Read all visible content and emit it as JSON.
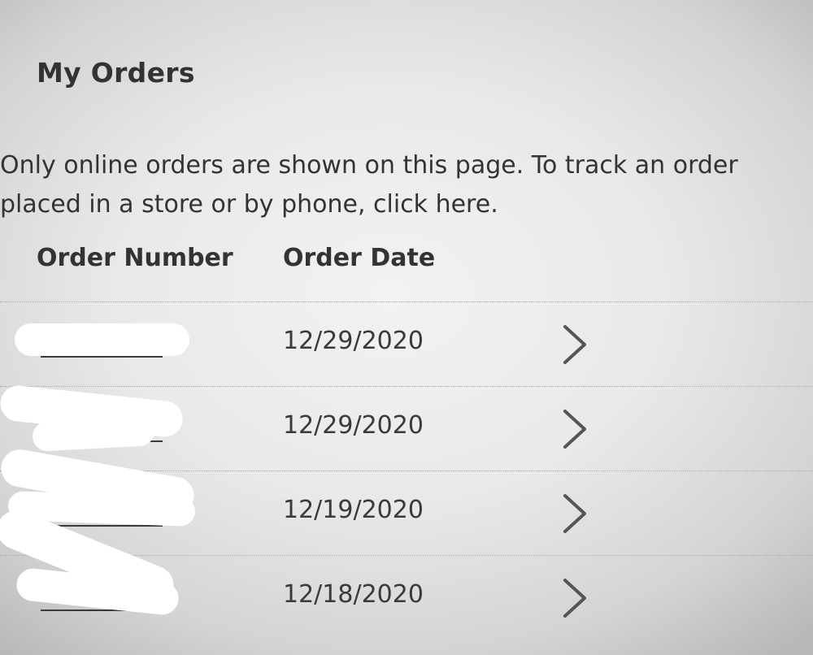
{
  "page": {
    "title": "My Orders",
    "notice": "Only online orders are shown on this page. To track an order placed in a store or by phone, click here."
  },
  "table": {
    "headers": {
      "order_number": "Order Number",
      "order_date": "Order Date"
    },
    "rows": [
      {
        "order_number": "",
        "order_date": "12/29/2020",
        "action_icon": "chevron-right-icon"
      },
      {
        "order_number": "",
        "order_date": "12/29/2020",
        "action_icon": "chevron-right-icon"
      },
      {
        "order_number": "",
        "order_date": "12/19/2020",
        "action_icon": "chevron-right-icon"
      },
      {
        "order_number": "",
        "order_date": "12/18/2020",
        "action_icon": "chevron-right-icon"
      }
    ]
  },
  "colors": {
    "text": "#333333",
    "divider": "#a9a9a9",
    "redaction": "#ffffff"
  }
}
